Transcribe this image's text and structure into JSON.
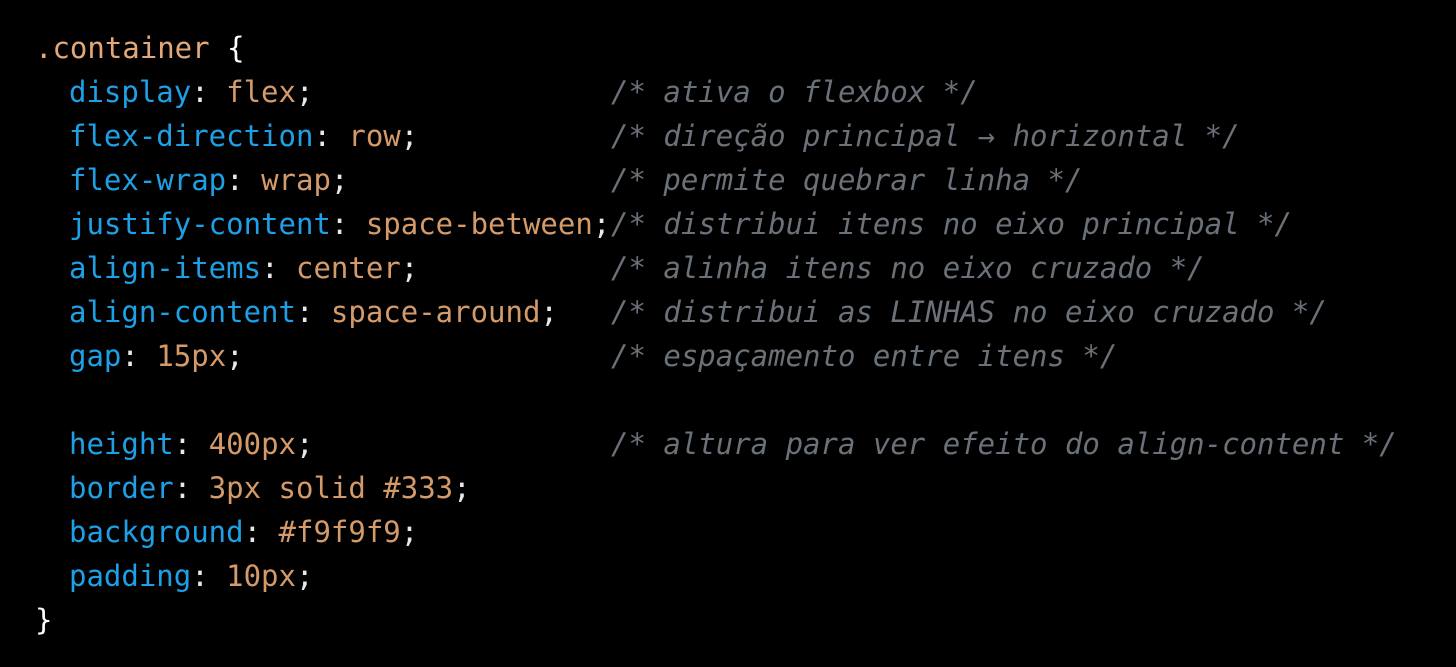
{
  "code": {
    "selector": ".container",
    "open_brace": "{",
    "close_brace": "}",
    "declarations": [
      {
        "property": "display",
        "value": "flex",
        "comment": "/* ativa o flexbox */"
      },
      {
        "property": "flex-direction",
        "value": "row",
        "comment": "/* direção principal → horizontal */"
      },
      {
        "property": "flex-wrap",
        "value": "wrap",
        "comment": "/* permite quebrar linha */"
      },
      {
        "property": "justify-content",
        "value": "space-between",
        "comment": "/* distribui itens no eixo principal */"
      },
      {
        "property": "align-items",
        "value": "center",
        "comment": "/* alinha itens no eixo cruzado */"
      },
      {
        "property": "align-content",
        "value": "space-around",
        "comment": "/* distribui as LINHAS no eixo cruzado */"
      },
      {
        "property": "gap",
        "value": "15px",
        "comment": "/* espaçamento entre itens */"
      },
      {
        "property": "height",
        "value": "400px",
        "comment": "/* altura para ver efeito do align-content */"
      },
      {
        "property": "border",
        "value": "3px solid #333",
        "comment": ""
      },
      {
        "property": "background",
        "value": "#f9f9f9",
        "comment": ""
      },
      {
        "property": "padding",
        "value": "10px",
        "comment": ""
      }
    ]
  },
  "colors": {
    "background": "#000000",
    "selector": "#e2a87a",
    "property": "#1ea0e6",
    "value": "#d49a6a",
    "comment": "#6b7178"
  }
}
